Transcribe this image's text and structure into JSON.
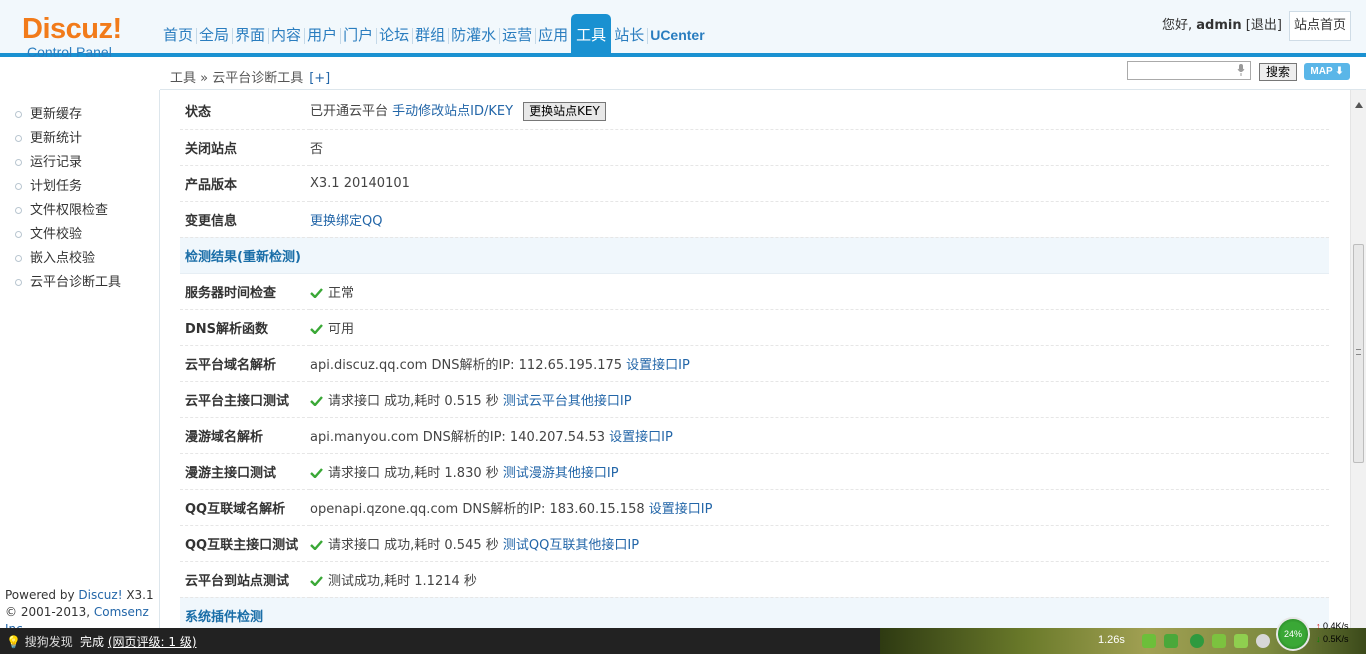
{
  "logo": {
    "brand": "Discuz",
    "bang": "!",
    "subtitle": "Control Panel"
  },
  "nav": [
    "首页",
    "全局",
    "界面",
    "内容",
    "用户",
    "门户",
    "论坛",
    "群组",
    "防灌水",
    "运营",
    "应用",
    "工具",
    "站长",
    "UCenter"
  ],
  "nav_active": "工具",
  "user": {
    "greeting": "您好,",
    "name": "admin",
    "logout": "[退出]",
    "site_home": "站点首页"
  },
  "breadcrumb": {
    "path": "工具 » 云平台诊断工具",
    "plus": "[+]"
  },
  "search": {
    "button": "搜索",
    "map": "MAP ⬇"
  },
  "sidebar": {
    "items": [
      "更新缓存",
      "更新统计",
      "运行记录",
      "计划任务",
      "文件权限检查",
      "文件校验",
      "嵌入点校验",
      "云平台诊断工具"
    ],
    "footer_powered_prefix": "Powered by ",
    "footer_brand": "Discuz!",
    "footer_version": " X3.1",
    "footer_copy_prefix": "© 2001-2013, ",
    "footer_company": "Comsenz Inc."
  },
  "rows": {
    "status": {
      "label": "状态",
      "text": "已开通云平台",
      "link": "手动修改站点ID/KEY",
      "button": "更换站点KEY"
    },
    "closed": {
      "label": "关闭站点",
      "value": "否"
    },
    "version": {
      "label": "产品版本",
      "value": "X3.1 20140101"
    },
    "change": {
      "label": "变更信息",
      "link": "更换绑定QQ"
    },
    "section1": "检测结果(重新检测)",
    "server_time": {
      "label": "服务器时间检查",
      "value": "正常"
    },
    "dns_func": {
      "label": "DNS解析函数",
      "value": "可用"
    },
    "cloud_dns": {
      "label": "云平台域名解析",
      "value": "api.discuz.qq.com DNS解析的IP: 112.65.195.175",
      "link": "设置接口IP"
    },
    "cloud_api": {
      "label": "云平台主接口测试",
      "value": "请求接口 成功,耗时 0.515 秒",
      "link": "测试云平台其他接口IP"
    },
    "manyou_dns": {
      "label": "漫游域名解析",
      "value": "api.manyou.com DNS解析的IP: 140.207.54.53",
      "link": "设置接口IP"
    },
    "manyou_api": {
      "label": "漫游主接口测试",
      "value": "请求接口 成功,耗时 1.830 秒",
      "link": "测试漫游其他接口IP"
    },
    "qq_dns": {
      "label": "QQ互联域名解析",
      "value": "openapi.qzone.qq.com DNS解析的IP: 183.60.15.158",
      "link": "设置接口IP"
    },
    "qq_api": {
      "label": "QQ互联主接口测试",
      "value": "请求接口 成功,耗时 0.545 秒",
      "link": "测试QQ互联其他接口IP"
    },
    "site_test": {
      "label": "云平台到站点测试",
      "value": "测试成功,耗时 1.1214 秒"
    },
    "section2": "系统插件检测"
  },
  "statusbar": {
    "discover": "搜狗发现",
    "done": "完成",
    "rating": "(网页评级: 1 级)",
    "time": "1.26s",
    "ring": "24%",
    "up": "0.4K/s",
    "down": "0.5K/s"
  },
  "colors": {
    "accent": "#1a91d1",
    "link": "#2366a8",
    "logo": "#f27b1a",
    "check": "#3aa836"
  }
}
